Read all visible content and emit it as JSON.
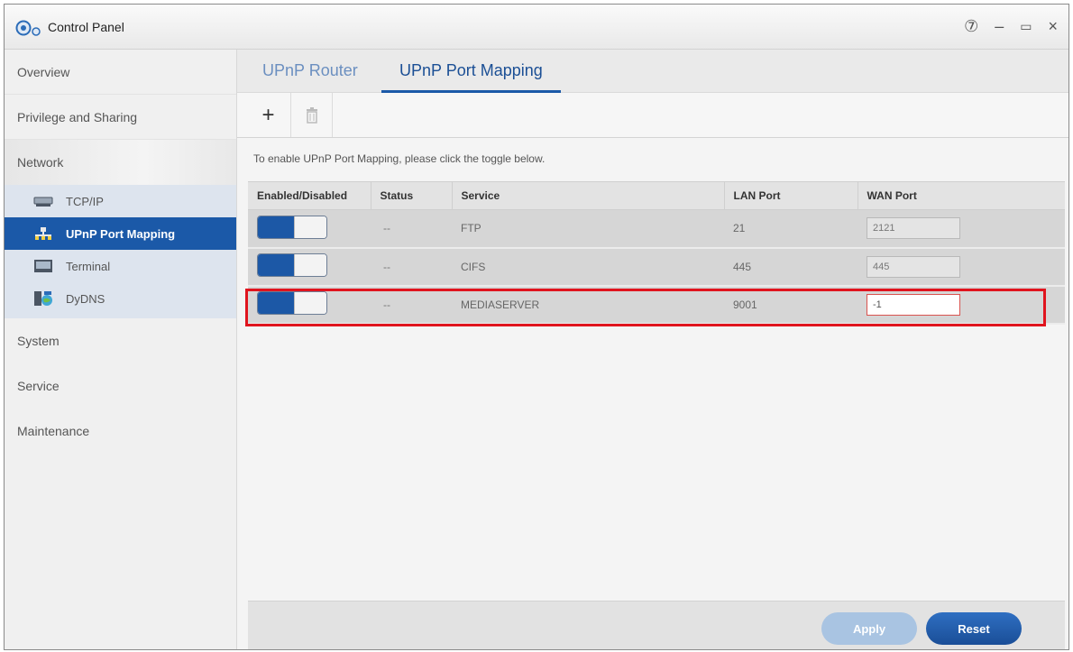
{
  "window": {
    "title": "Control Panel",
    "help_glyph": "⑦",
    "minimize_glyph": "–",
    "maximize_glyph": "▭",
    "close_glyph": "×"
  },
  "sidebar": {
    "items": [
      {
        "label": "Overview"
      },
      {
        "label": "Privilege and Sharing"
      },
      {
        "label": "Network"
      },
      {
        "label": "System"
      },
      {
        "label": "Service"
      },
      {
        "label": "Maintenance"
      }
    ],
    "network_subitems": [
      {
        "label": "TCP/IP",
        "icon": "network-adapter-icon"
      },
      {
        "label": "UPnP Port Mapping",
        "icon": "port-mapping-icon",
        "active": true
      },
      {
        "label": "Terminal",
        "icon": "terminal-icon"
      },
      {
        "label": "DyDNS",
        "icon": "dydns-icon"
      }
    ]
  },
  "tabs": [
    {
      "label": "UPnP Router"
    },
    {
      "label": "UPnP Port Mapping",
      "active": true
    }
  ],
  "toolbar": {
    "add_glyph": "+",
    "delete_glyph": "🗑"
  },
  "hint": "To enable UPnP Port Mapping, please click the toggle below.",
  "table": {
    "headers": [
      "Enabled/Disabled",
      "Status",
      "Service",
      "LAN Port",
      "WAN Port"
    ],
    "rows": [
      {
        "enabled": true,
        "status": "--",
        "service": "FTP",
        "lan_port": "21",
        "wan_port": "2121"
      },
      {
        "enabled": true,
        "status": "--",
        "service": "CIFS",
        "lan_port": "445",
        "wan_port": "445"
      },
      {
        "enabled": true,
        "status": "--",
        "service": "MEDIASERVER",
        "lan_port": "9001",
        "wan_port": "-1"
      }
    ]
  },
  "footer": {
    "apply_label": "Apply",
    "reset_label": "Reset"
  },
  "colors": {
    "accent": "#1b59a8",
    "highlight": "#e0141e"
  }
}
